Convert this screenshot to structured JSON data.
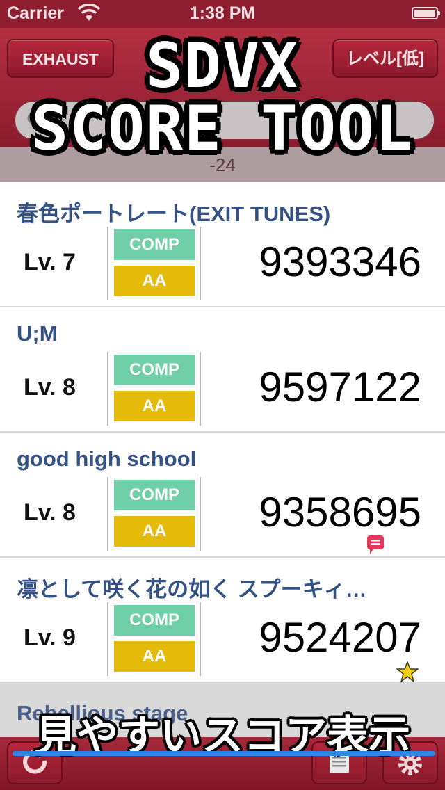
{
  "status_bar": {
    "carrier": "Carrier",
    "time": "1:38 PM"
  },
  "header": {
    "left_button": "EXHAUST",
    "right_button": "レベル[低]",
    "subinfo": "-24"
  },
  "overlay": {
    "title_line1": "SDVX",
    "title_line2": "SCORE TOOL",
    "caption": "見やすいスコア表示"
  },
  "songs": [
    {
      "title": "春色ポートレート(EXIT TUNES)",
      "level": "Lv. 7",
      "clear": "COMP",
      "grade": "AA",
      "score": "9393346"
    },
    {
      "title": "U;M",
      "level": "Lv. 8",
      "clear": "COMP",
      "grade": "AA",
      "score": "9597122"
    },
    {
      "title": "good high school",
      "level": "Lv. 8",
      "clear": "COMP",
      "grade": "AA",
      "score": "9358695",
      "marker": "comment-icon"
    },
    {
      "title": "凛として咲く花の如く スプーキィ…",
      "level": "Lv. 9",
      "clear": "COMP",
      "grade": "AA",
      "score": "9524207",
      "marker": "star-icon"
    }
  ],
  "next_song": {
    "title": "Rebellious stage"
  },
  "colors": {
    "accent": "#9d2436",
    "comp": "#6ecfa8",
    "grade": "#e4bb09",
    "title": "#355285",
    "underline": "#2f86e8"
  },
  "footer_icons": [
    "refresh-icon",
    "memo-icon",
    "gear-icon"
  ]
}
